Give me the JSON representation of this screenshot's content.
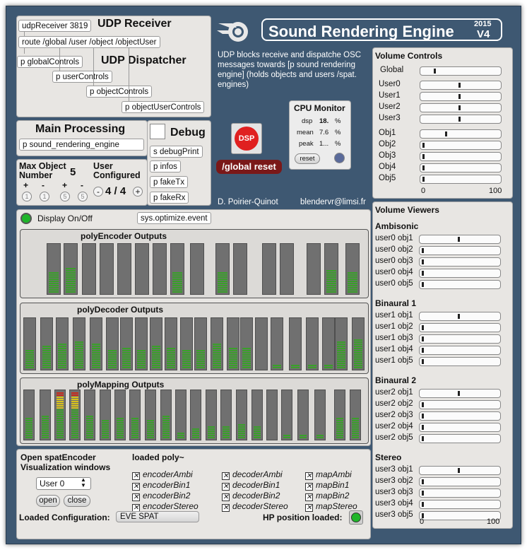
{
  "udp_receiver": {
    "title": "UDP Receiver",
    "receiver_obj": "udpReceiver 3819",
    "route_obj": "route /global /user /object /objectUser"
  },
  "udp_dispatcher": {
    "title": "UDP Dispatcher",
    "objects": [
      "p globalControls",
      "p userControls",
      "p objectControls",
      "p objectUserControls"
    ]
  },
  "main_processing": {
    "title": "Main Processing",
    "object": "p sound_rendering_engine"
  },
  "debug": {
    "title": "Debug",
    "objects": [
      "s debugPrint",
      "p infos",
      "p fakeTx",
      "p fakeRx"
    ]
  },
  "max_object": {
    "label_line1": "Max Object",
    "label_line2": "Number",
    "value": "5",
    "buttons": [
      "+",
      "-",
      "+",
      "-"
    ],
    "circles": [
      "1",
      "1",
      "5",
      "5"
    ]
  },
  "user_configured": {
    "label_line1": "User",
    "label_line2": "Configured",
    "minus": "-",
    "value": "4 / 4",
    "plus": "+"
  },
  "header": {
    "title": "Sound Rendering Engine",
    "year": "2015",
    "version": "V4",
    "description": "UDP blocks receive and dispatche OSC messages towards [p sound rendering engine] (holds objects and users /spat. engines)"
  },
  "dsp": {
    "label": "DSP",
    "reset_label": "/global reset"
  },
  "cpu_monitor": {
    "title": "CPU Monitor",
    "rows": [
      {
        "label": "dsp",
        "value": "18.",
        "unit": "%"
      },
      {
        "label": "mean",
        "value": "7.6",
        "unit": "%"
      },
      {
        "label": "peak",
        "value": "1...",
        "unit": "%"
      }
    ],
    "reset_label": "reset"
  },
  "credits": {
    "author": "D. Poirier-Quinot",
    "email": "blendervr@limsi.fr"
  },
  "display": {
    "toggle_label": "Display On/Off",
    "optimize_obj": "sys.optimize.event"
  },
  "meters": {
    "encoder_title": "polyEncoder Outputs",
    "decoder_title": "polyDecoder Outputs",
    "mapping_title": "polyMapping Outputs",
    "encoder_levels": [
      0.45,
      0.5,
      0,
      0,
      0,
      0,
      0,
      0.42,
      0,
      0.42,
      0,
      0,
      0,
      0,
      0.47,
      0.42
    ],
    "decoder_levels": [
      0.4,
      0.45,
      0.5,
      0.57,
      0.5,
      0.4,
      0.43,
      0.4,
      0.47,
      0.43,
      0.4,
      0.38,
      0.5,
      0.43,
      0.43,
      0,
      0.07,
      0.07,
      0.07,
      0.07,
      0.55,
      0.6
    ],
    "mapping_levels": [
      0.43,
      0.5,
      0.95,
      0.95,
      0.48,
      0.4,
      0.42,
      0.43,
      0.4,
      0.5,
      0.15,
      0.22,
      0.25,
      0.25,
      0.3,
      0.25,
      0,
      0.08,
      0.08,
      0.08,
      0.08,
      0.45,
      0.45
    ]
  },
  "spat_window": {
    "title_line1": "Open spatEncoder",
    "title_line2": "Visualization windows",
    "user_select": "User 0",
    "open_label": "open",
    "close_label": "close"
  },
  "loaded_poly": {
    "title": "loaded poly~",
    "checkboxes": [
      [
        "encoderAmbi",
        "encoderBin1",
        "encoderBin2",
        "encoderStereo"
      ],
      [
        "decoderAmbi",
        "decoderBin1",
        "decoderBin2",
        "decoderStereo"
      ],
      [
        "mapAmbi",
        "mapBin1",
        "mapBin2",
        "mapStereo"
      ]
    ]
  },
  "config": {
    "label": "Loaded Configuration:",
    "value": "EVE SPAT",
    "hp_label": "HP position loaded:"
  },
  "volume_controls": {
    "title": "Volume Controls",
    "rows": [
      {
        "label": "Global",
        "value": 0.15
      },
      {
        "label": "User0",
        "value": 0.48
      },
      {
        "label": "User1",
        "value": 0.48
      },
      {
        "label": "User2",
        "value": 0.48
      },
      {
        "label": "User3",
        "value": 0.48
      },
      {
        "label": "Obj1",
        "value": 0.3
      },
      {
        "label": "Obj2",
        "value": 0
      },
      {
        "label": "Obj3",
        "value": 0
      },
      {
        "label": "Obj4",
        "value": 0
      },
      {
        "label": "Obj5",
        "value": 0
      }
    ],
    "scale_min": "0",
    "scale_max": "100"
  },
  "volume_viewers": {
    "title": "Volume Viewers",
    "groups": [
      {
        "title": "Ambisonic",
        "rows": [
          {
            "label": "user0 obj1",
            "value": 0.48
          },
          {
            "label": "user0 obj2",
            "value": 0
          },
          {
            "label": "user0 obj3",
            "value": 0
          },
          {
            "label": "user0 obj4",
            "value": 0
          },
          {
            "label": "user0 obj5",
            "value": 0
          }
        ]
      },
      {
        "title": "Binaural 1",
        "rows": [
          {
            "label": "user1 obj1",
            "value": 0.48
          },
          {
            "label": "user1 obj2",
            "value": 0
          },
          {
            "label": "user1 obj3",
            "value": 0
          },
          {
            "label": "user1 obj4",
            "value": 0
          },
          {
            "label": "user1 obj5",
            "value": 0
          }
        ]
      },
      {
        "title": "Binaural 2",
        "rows": [
          {
            "label": "user2 obj1",
            "value": 0.48
          },
          {
            "label": "user2 obj2",
            "value": 0
          },
          {
            "label": "user2 obj3",
            "value": 0
          },
          {
            "label": "user2 obj4",
            "value": 0
          },
          {
            "label": "user2 obj5",
            "value": 0
          }
        ]
      },
      {
        "title": "Stereo",
        "rows": [
          {
            "label": "user3 obj1",
            "value": 0.48
          },
          {
            "label": "user3 obj2",
            "value": 0
          },
          {
            "label": "user3 obj3",
            "value": 0
          },
          {
            "label": "user3 obj4",
            "value": 0
          },
          {
            "label": "user3 obj5",
            "value": 0
          }
        ]
      }
    ],
    "scale_min": "0",
    "scale_max": "100"
  },
  "colors": {
    "background": "#3e5872",
    "panel": "#e8e6e3",
    "meter_green": "#3aa02a",
    "meter_yellow": "#d8c21a",
    "meter_red": "#cc2a1a",
    "dsp_red": "#e02020"
  }
}
